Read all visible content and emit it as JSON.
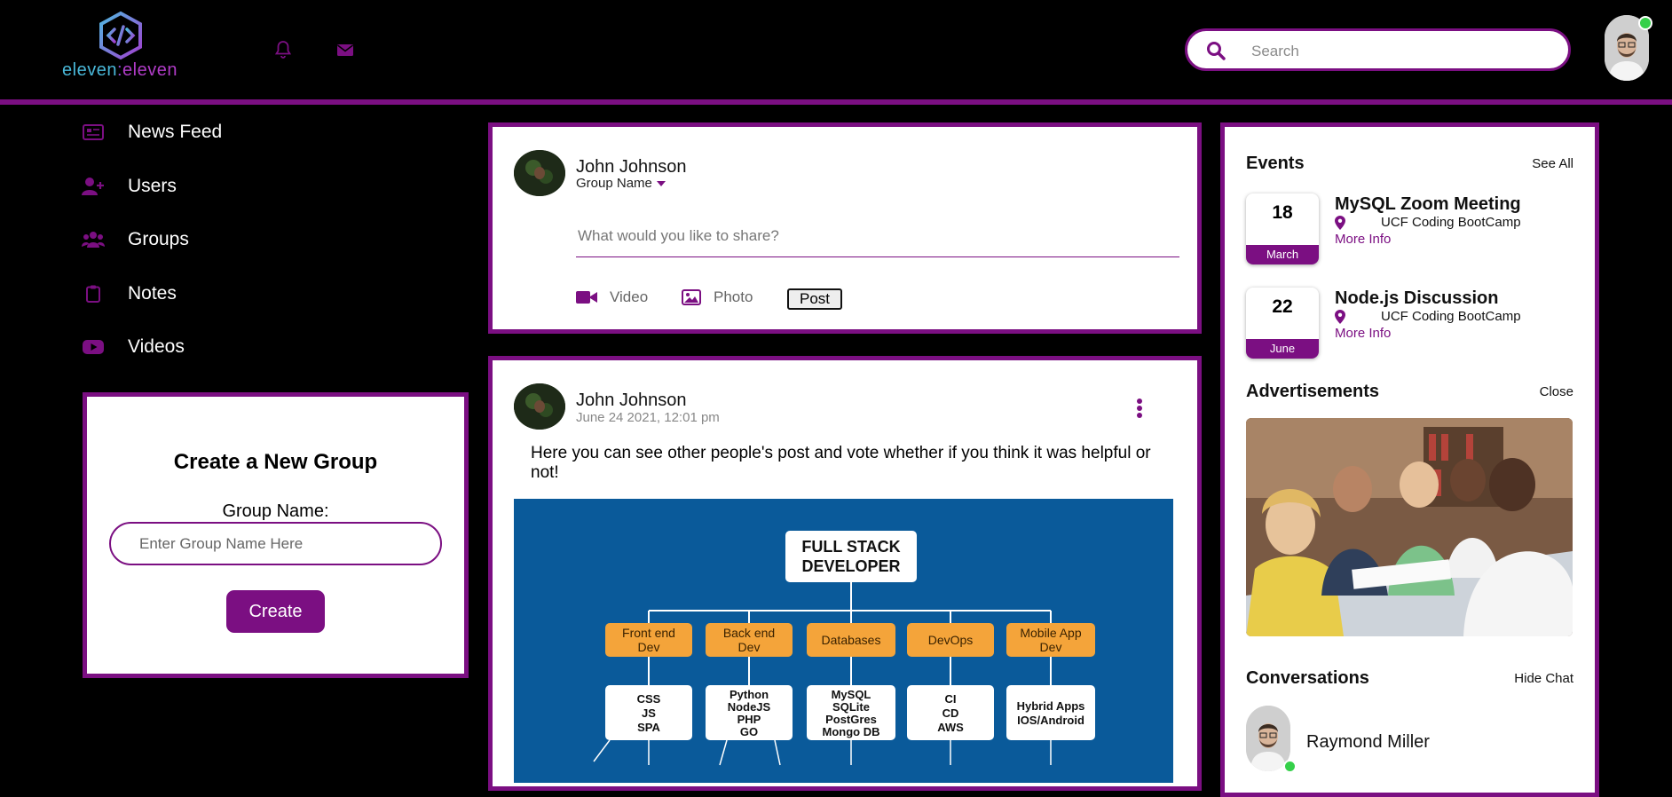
{
  "brand": {
    "logo_part1": "eleven",
    "logo_colon": ":",
    "logo_part2": "eleven",
    "colors": {
      "accent": "#7b0f82",
      "background": "#000000",
      "online": "#35d04a"
    }
  },
  "header": {
    "icons": [
      "bell-icon",
      "envelope-icon"
    ],
    "search_placeholder": "Search"
  },
  "nav": {
    "items": [
      {
        "label": "News Feed",
        "icon": "newspaper-icon"
      },
      {
        "label": "Users",
        "icon": "user-plus-icon"
      },
      {
        "label": "Groups",
        "icon": "users-icon"
      },
      {
        "label": "Notes",
        "icon": "clipboard-icon"
      },
      {
        "label": "Videos",
        "icon": "youtube-icon"
      }
    ]
  },
  "create_group": {
    "title": "Create a New Group",
    "label": "Group Name:",
    "placeholder": "Enter Group Name Here",
    "button": "Create"
  },
  "composer": {
    "author": "John Johnson",
    "group": "Group Name",
    "placeholder": "What would you like to share?",
    "video_label": "Video",
    "photo_label": "Photo",
    "post_label": "Post"
  },
  "post": {
    "author": "John Johnson",
    "date": "June 24 2021, 12:01 pm",
    "text": "Here you can see other people's post and vote whether if you think it was helpful or not!",
    "diagram": {
      "root": "FULL STACK DEVELOPER",
      "branches": [
        {
          "title": "Front end Dev",
          "items": "CSS JS SPA"
        },
        {
          "title": "Back end Dev",
          "items": "Python NodeJS PHP GO"
        },
        {
          "title": "Databases",
          "items": "MySQL SQLite PostGres Mongo DB"
        },
        {
          "title": "DevOps",
          "items": "CI CD AWS"
        },
        {
          "title": "Mobile App Dev",
          "items": "Hybrid Apps IOS/Android"
        }
      ]
    }
  },
  "sidebar": {
    "events_title": "Events",
    "events_link": "See All",
    "events": [
      {
        "day": "18",
        "month": "March",
        "title": "MySQL Zoom Meeting",
        "location": "UCF Coding BootCamp",
        "more": "More Info"
      },
      {
        "day": "22",
        "month": "June",
        "title": "Node.js Discussion",
        "location": "UCF Coding BootCamp",
        "more": "More Info"
      }
    ],
    "ads_title": "Advertisements",
    "ads_link": "Close",
    "conversations_title": "Conversations",
    "conversations_link": "Hide Chat",
    "conversation_name": "Raymond Miller"
  }
}
